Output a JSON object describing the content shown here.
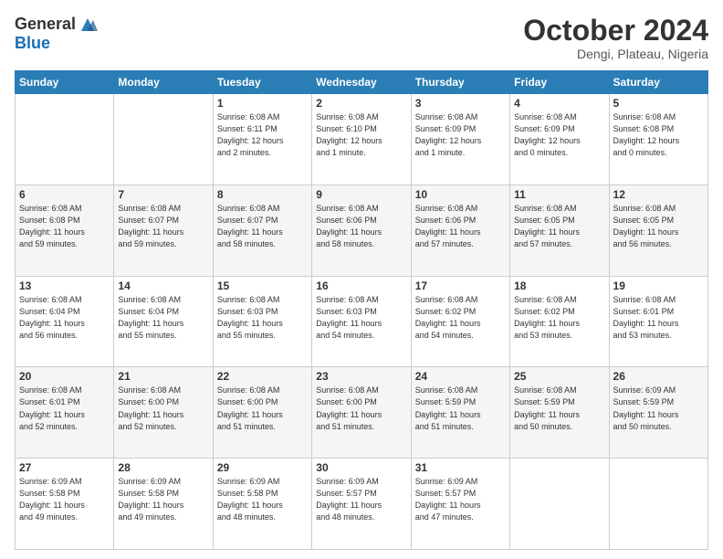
{
  "header": {
    "logo_general": "General",
    "logo_blue": "Blue",
    "month_title": "October 2024",
    "location": "Dengi, Plateau, Nigeria"
  },
  "calendar": {
    "headers": [
      "Sunday",
      "Monday",
      "Tuesday",
      "Wednesday",
      "Thursday",
      "Friday",
      "Saturday"
    ],
    "weeks": [
      [
        {
          "day": "",
          "text": ""
        },
        {
          "day": "",
          "text": ""
        },
        {
          "day": "1",
          "text": "Sunrise: 6:08 AM\nSunset: 6:11 PM\nDaylight: 12 hours\nand 2 minutes."
        },
        {
          "day": "2",
          "text": "Sunrise: 6:08 AM\nSunset: 6:10 PM\nDaylight: 12 hours\nand 1 minute."
        },
        {
          "day": "3",
          "text": "Sunrise: 6:08 AM\nSunset: 6:09 PM\nDaylight: 12 hours\nand 1 minute."
        },
        {
          "day": "4",
          "text": "Sunrise: 6:08 AM\nSunset: 6:09 PM\nDaylight: 12 hours\nand 0 minutes."
        },
        {
          "day": "5",
          "text": "Sunrise: 6:08 AM\nSunset: 6:08 PM\nDaylight: 12 hours\nand 0 minutes."
        }
      ],
      [
        {
          "day": "6",
          "text": "Sunrise: 6:08 AM\nSunset: 6:08 PM\nDaylight: 11 hours\nand 59 minutes."
        },
        {
          "day": "7",
          "text": "Sunrise: 6:08 AM\nSunset: 6:07 PM\nDaylight: 11 hours\nand 59 minutes."
        },
        {
          "day": "8",
          "text": "Sunrise: 6:08 AM\nSunset: 6:07 PM\nDaylight: 11 hours\nand 58 minutes."
        },
        {
          "day": "9",
          "text": "Sunrise: 6:08 AM\nSunset: 6:06 PM\nDaylight: 11 hours\nand 58 minutes."
        },
        {
          "day": "10",
          "text": "Sunrise: 6:08 AM\nSunset: 6:06 PM\nDaylight: 11 hours\nand 57 minutes."
        },
        {
          "day": "11",
          "text": "Sunrise: 6:08 AM\nSunset: 6:05 PM\nDaylight: 11 hours\nand 57 minutes."
        },
        {
          "day": "12",
          "text": "Sunrise: 6:08 AM\nSunset: 6:05 PM\nDaylight: 11 hours\nand 56 minutes."
        }
      ],
      [
        {
          "day": "13",
          "text": "Sunrise: 6:08 AM\nSunset: 6:04 PM\nDaylight: 11 hours\nand 56 minutes."
        },
        {
          "day": "14",
          "text": "Sunrise: 6:08 AM\nSunset: 6:04 PM\nDaylight: 11 hours\nand 55 minutes."
        },
        {
          "day": "15",
          "text": "Sunrise: 6:08 AM\nSunset: 6:03 PM\nDaylight: 11 hours\nand 55 minutes."
        },
        {
          "day": "16",
          "text": "Sunrise: 6:08 AM\nSunset: 6:03 PM\nDaylight: 11 hours\nand 54 minutes."
        },
        {
          "day": "17",
          "text": "Sunrise: 6:08 AM\nSunset: 6:02 PM\nDaylight: 11 hours\nand 54 minutes."
        },
        {
          "day": "18",
          "text": "Sunrise: 6:08 AM\nSunset: 6:02 PM\nDaylight: 11 hours\nand 53 minutes."
        },
        {
          "day": "19",
          "text": "Sunrise: 6:08 AM\nSunset: 6:01 PM\nDaylight: 11 hours\nand 53 minutes."
        }
      ],
      [
        {
          "day": "20",
          "text": "Sunrise: 6:08 AM\nSunset: 6:01 PM\nDaylight: 11 hours\nand 52 minutes."
        },
        {
          "day": "21",
          "text": "Sunrise: 6:08 AM\nSunset: 6:00 PM\nDaylight: 11 hours\nand 52 minutes."
        },
        {
          "day": "22",
          "text": "Sunrise: 6:08 AM\nSunset: 6:00 PM\nDaylight: 11 hours\nand 51 minutes."
        },
        {
          "day": "23",
          "text": "Sunrise: 6:08 AM\nSunset: 6:00 PM\nDaylight: 11 hours\nand 51 minutes."
        },
        {
          "day": "24",
          "text": "Sunrise: 6:08 AM\nSunset: 5:59 PM\nDaylight: 11 hours\nand 51 minutes."
        },
        {
          "day": "25",
          "text": "Sunrise: 6:08 AM\nSunset: 5:59 PM\nDaylight: 11 hours\nand 50 minutes."
        },
        {
          "day": "26",
          "text": "Sunrise: 6:09 AM\nSunset: 5:59 PM\nDaylight: 11 hours\nand 50 minutes."
        }
      ],
      [
        {
          "day": "27",
          "text": "Sunrise: 6:09 AM\nSunset: 5:58 PM\nDaylight: 11 hours\nand 49 minutes."
        },
        {
          "day": "28",
          "text": "Sunrise: 6:09 AM\nSunset: 5:58 PM\nDaylight: 11 hours\nand 49 minutes."
        },
        {
          "day": "29",
          "text": "Sunrise: 6:09 AM\nSunset: 5:58 PM\nDaylight: 11 hours\nand 48 minutes."
        },
        {
          "day": "30",
          "text": "Sunrise: 6:09 AM\nSunset: 5:57 PM\nDaylight: 11 hours\nand 48 minutes."
        },
        {
          "day": "31",
          "text": "Sunrise: 6:09 AM\nSunset: 5:57 PM\nDaylight: 11 hours\nand 47 minutes."
        },
        {
          "day": "",
          "text": ""
        },
        {
          "day": "",
          "text": ""
        }
      ]
    ]
  }
}
